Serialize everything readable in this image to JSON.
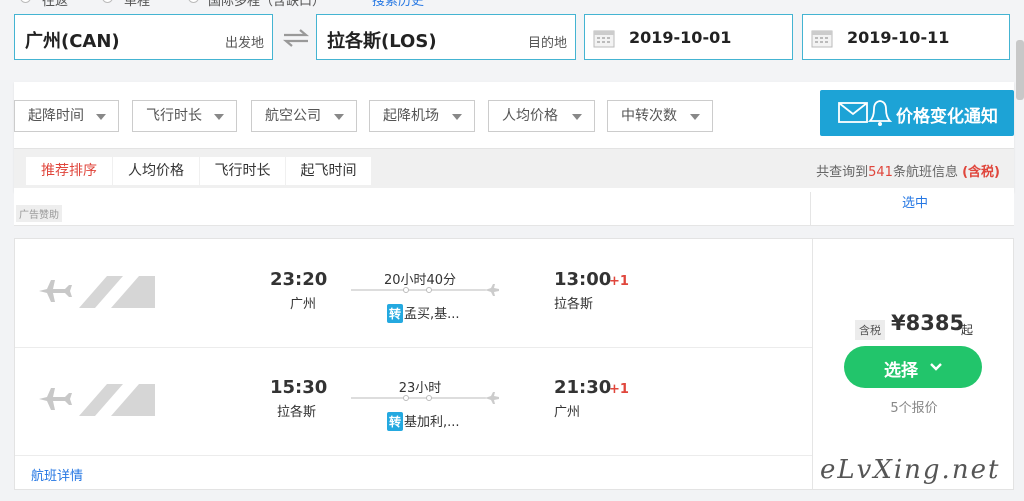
{
  "trip_types": [
    "往返",
    "单程",
    "国际多程（含缺口）"
  ],
  "search_history": "搜索历史",
  "origin": {
    "city": "广州(CAN)",
    "hint": "出发地"
  },
  "destination": {
    "city": "拉各斯(LOS)",
    "hint": "目的地"
  },
  "depart_date": "2019-10-01",
  "return_date": "2019-10-11",
  "filters": [
    "起降时间",
    "飞行时长",
    "航空公司",
    "起降机场",
    "人均价格",
    "中转次数"
  ],
  "notify_label": "价格变化通知",
  "sort_tabs": [
    "推荐排序",
    "人均价格",
    "飞行时长",
    "起飞时间"
  ],
  "result_summary": {
    "prefix": "共查询到",
    "count": "541",
    "suffix": "条航班信息",
    "tax": "(含税)"
  },
  "ad": {
    "badge": "广告赞助",
    "link": "选中"
  },
  "flight": {
    "outbound": {
      "dep_time": "23:20",
      "dep_city": "广州",
      "duration": "20小时40分",
      "transfer_badge": "转",
      "transfer": "孟买,基...",
      "arr_time": "13:00",
      "arr_plus": "+1",
      "arr_city": "拉各斯"
    },
    "inbound": {
      "dep_time": "15:30",
      "dep_city": "拉各斯",
      "duration": "23小时",
      "transfer_badge": "转",
      "transfer": "基加利,...",
      "arr_time": "21:30",
      "arr_plus": "+1",
      "arr_city": "广州"
    },
    "details_link": "航班详情",
    "tax_label": "含税",
    "price": "¥8385",
    "price_suffix": "起",
    "select_label": "选择",
    "quote_count": "5个报价"
  },
  "watermark": "eLvXing.net",
  "colors": {
    "accent_blue": "#1da3d6",
    "select_green": "#22c56b",
    "highlight_red": "#e0463c",
    "link_blue": "#2577e3"
  }
}
